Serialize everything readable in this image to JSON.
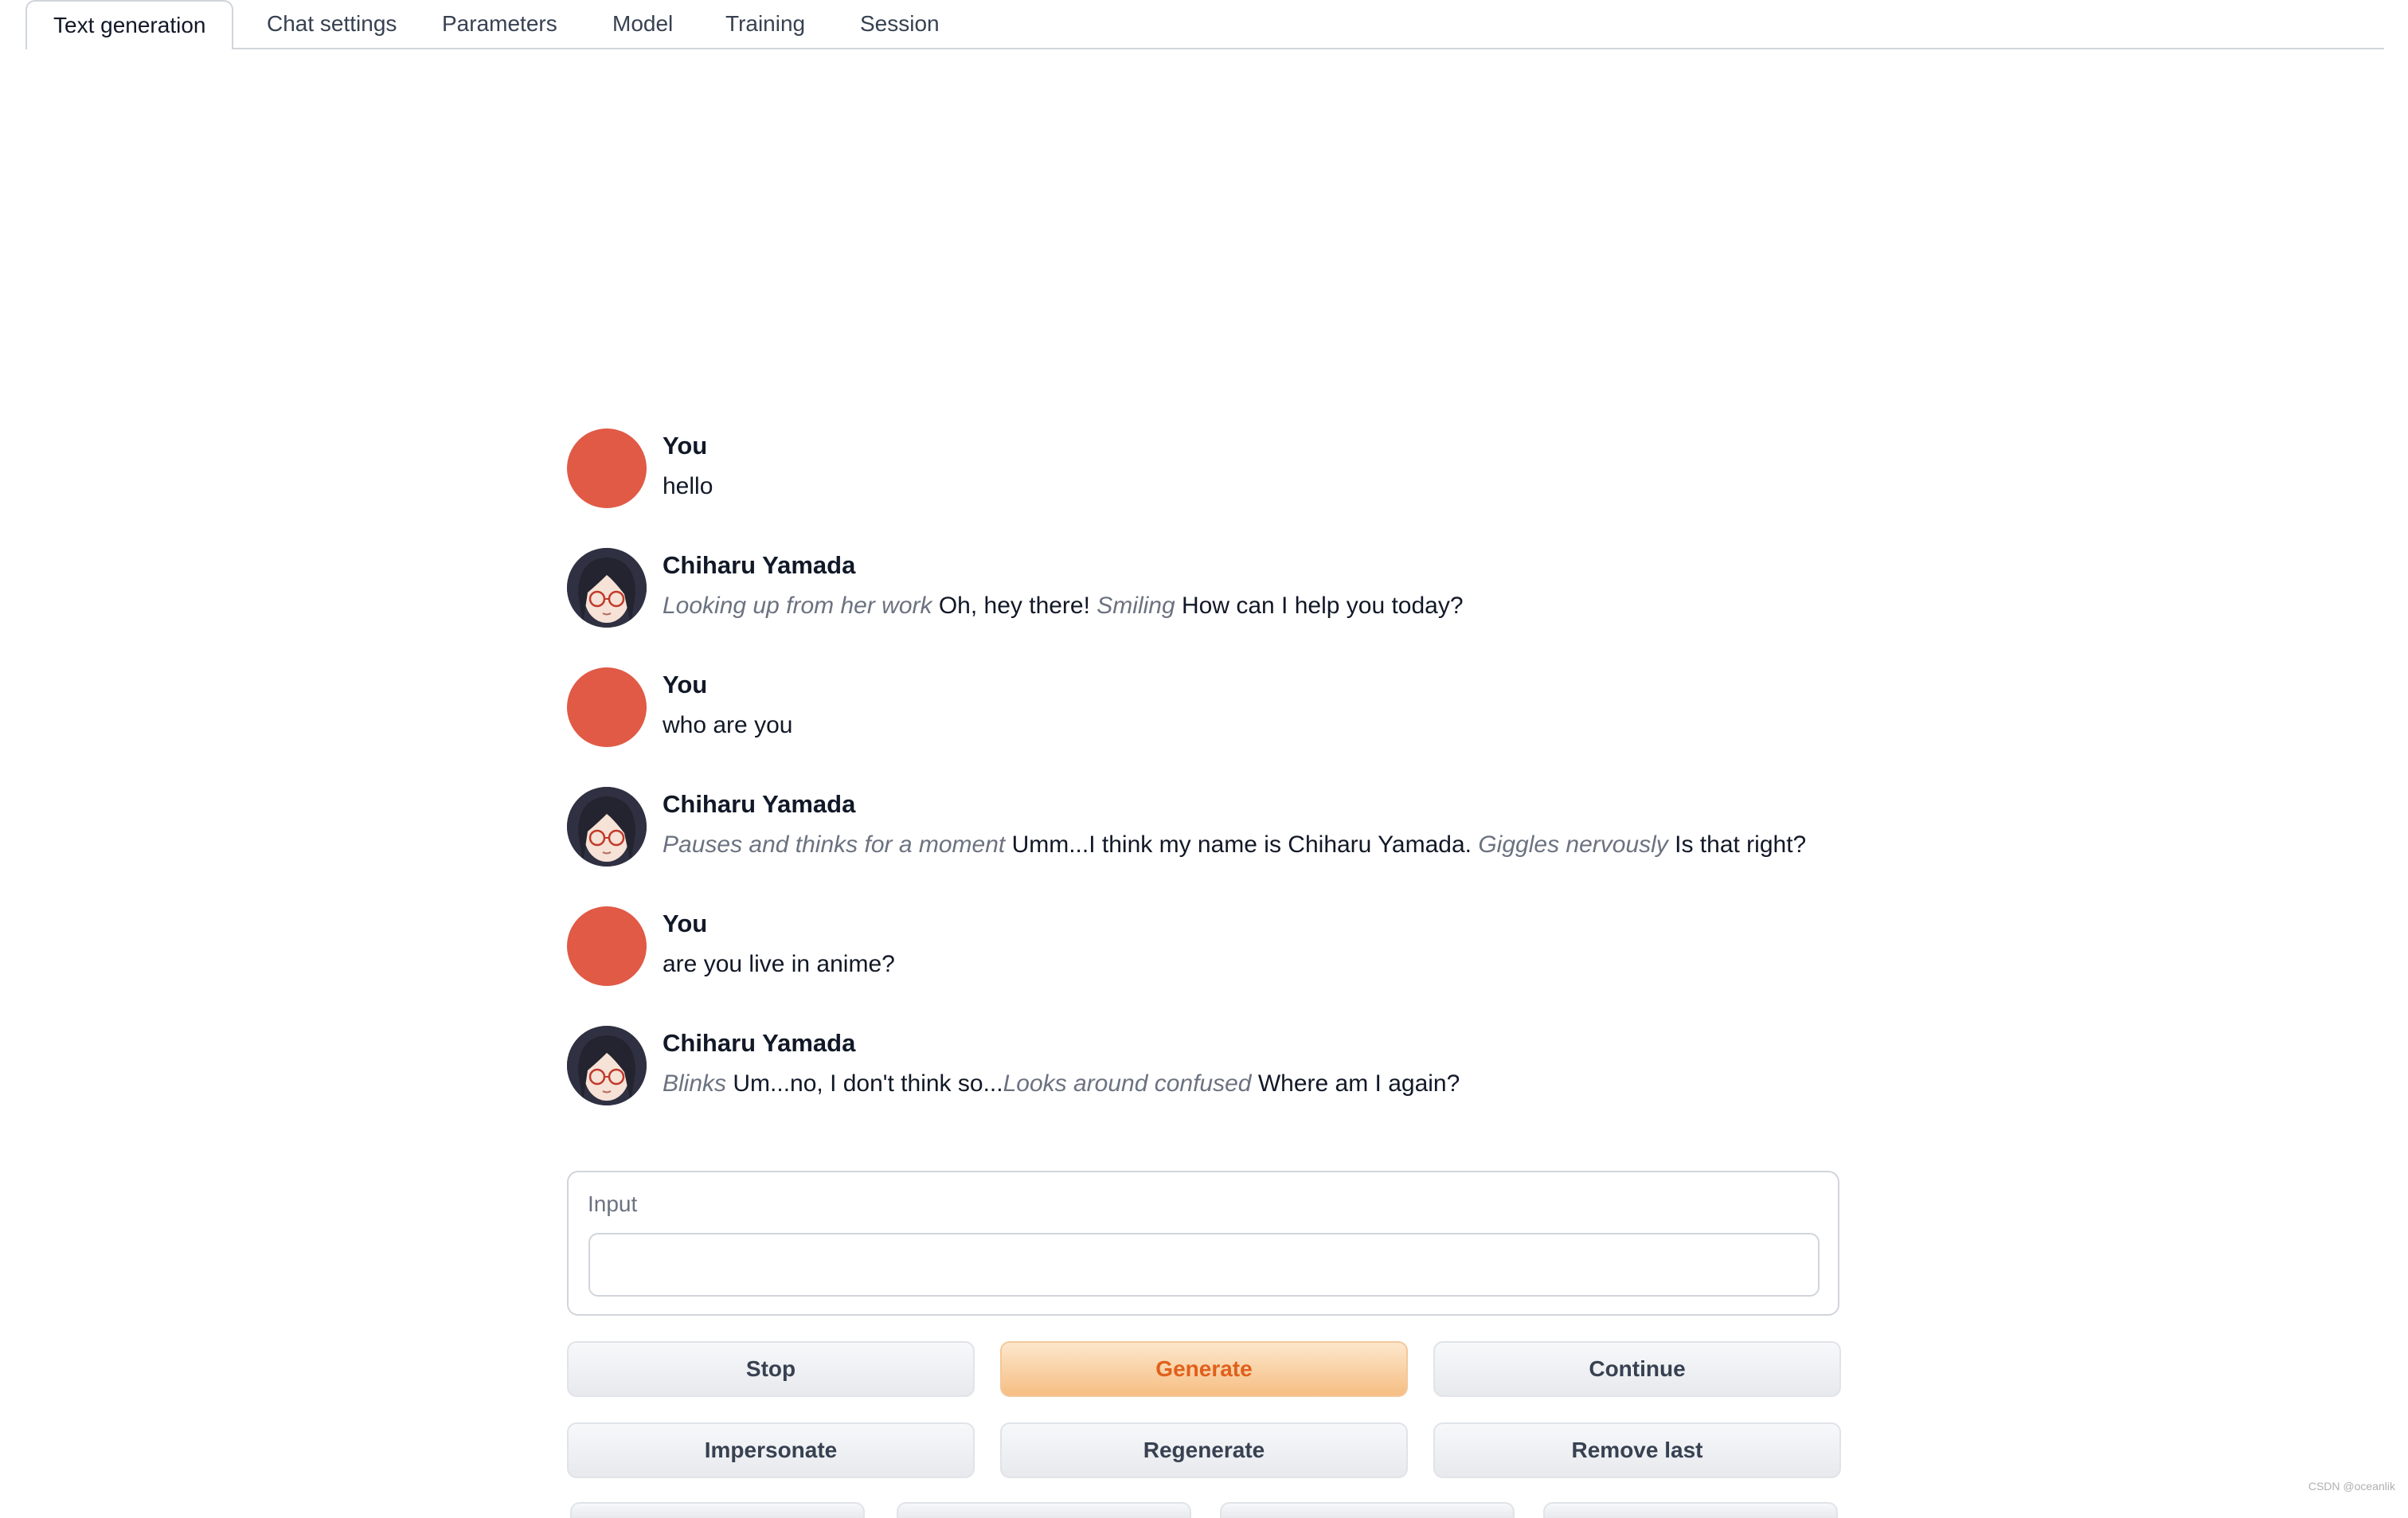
{
  "tabs": [
    {
      "label": "Text generation",
      "active": true
    },
    {
      "label": "Chat settings"
    },
    {
      "label": "Parameters"
    },
    {
      "label": "Model"
    },
    {
      "label": "Training"
    },
    {
      "label": "Session"
    }
  ],
  "chat": {
    "messages": [
      {
        "role": "user",
        "name": "You",
        "parts": [
          {
            "text": "hello"
          }
        ]
      },
      {
        "role": "bot",
        "name": "Chiharu Yamada",
        "parts": [
          {
            "italic": true,
            "text": "Looking up from her work"
          },
          {
            "text": " Oh, hey there! "
          },
          {
            "italic": true,
            "text": "Smiling"
          },
          {
            "text": " How can I help you today?"
          }
        ]
      },
      {
        "role": "user",
        "name": "You",
        "parts": [
          {
            "text": "who are you"
          }
        ]
      },
      {
        "role": "bot",
        "name": "Chiharu Yamada",
        "parts": [
          {
            "italic": true,
            "text": "Pauses and thinks for a moment"
          },
          {
            "text": " Umm...I think my name is Chiharu Yamada. "
          },
          {
            "italic": true,
            "text": "Giggles nervously"
          },
          {
            "text": " Is that right?"
          }
        ]
      },
      {
        "role": "user",
        "name": "You",
        "parts": [
          {
            "text": "are you live in anime?"
          }
        ]
      },
      {
        "role": "bot",
        "name": "Chiharu Yamada",
        "parts": [
          {
            "italic": true,
            "text": "Blinks"
          },
          {
            "text": " Um...no, I don't think so..."
          },
          {
            "italic": true,
            "text": "Looks around confused"
          },
          {
            "text": " Where am I again?"
          }
        ]
      }
    ]
  },
  "input": {
    "label": "Input",
    "value": "",
    "placeholder": ""
  },
  "buttons": {
    "row1": [
      {
        "label": "Stop",
        "variant": "secondary"
      },
      {
        "label": "Generate",
        "variant": "primary"
      },
      {
        "label": "Continue",
        "variant": "secondary"
      }
    ],
    "row2": [
      {
        "label": "Impersonate",
        "variant": "secondary"
      },
      {
        "label": "Regenerate",
        "variant": "secondary"
      },
      {
        "label": "Remove last",
        "variant": "secondary"
      }
    ]
  },
  "watermark": "CSDN @oceanlik",
  "colors": {
    "user_avatar": "#e05a46",
    "primary_text": "#e0601c",
    "primary_bg": "#f6be83"
  },
  "icons": {
    "user_avatar": "red-circle-avatar",
    "bot_avatar": "anime-girl-avatar"
  }
}
